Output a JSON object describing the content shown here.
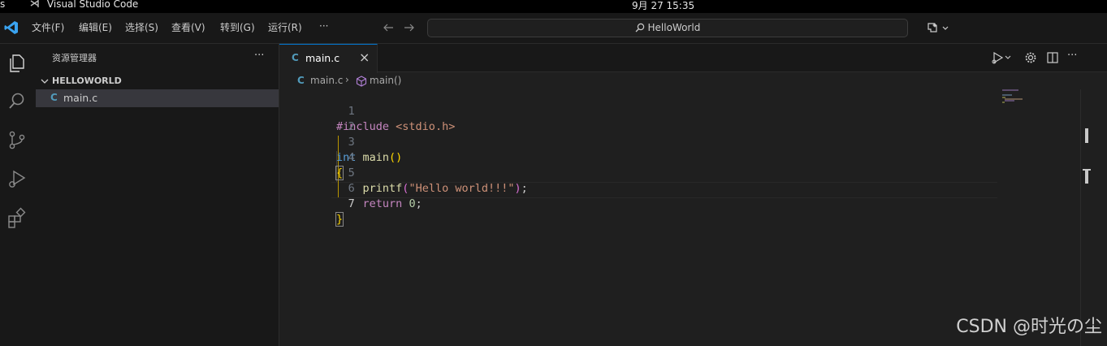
{
  "system_bar": {
    "app_fragment": "s",
    "app_name": "Visual Studio Code",
    "clock": "9月 27  15:35"
  },
  "menu": [
    "文件(F)",
    "编辑(E)",
    "选择(S)",
    "查看(V)",
    "转到(G)",
    "运行(R)",
    "···"
  ],
  "search": {
    "label": "HelloWorld"
  },
  "sidebar": {
    "title": "资源管理器",
    "more": "···",
    "folder": "HELLOWORLD",
    "files": [
      {
        "icon": "C",
        "name": "main.c"
      }
    ]
  },
  "editor": {
    "tab": {
      "icon": "C",
      "label": "main.c",
      "close": "×"
    },
    "breadcrumb": {
      "file_icon": "C",
      "file": "main.c",
      "separator": "›",
      "symbol": "main()"
    },
    "active_line": 7,
    "lines": [
      "#include <stdio.h>",
      "",
      "int main()",
      "{",
      "    printf(\"Hello world!!!\");",
      "    return 0;",
      "}"
    ]
  },
  "watermark": "CSDN @时光の尘",
  "colors": {
    "accent": "#0078d4",
    "c_icon": "#519aba",
    "keyword_preprocessor": "#c586c0",
    "string": "#ce9178",
    "type": "#569cd6",
    "function": "#dcdcaa",
    "bracket": "#ffd700",
    "number": "#b5cea8"
  }
}
